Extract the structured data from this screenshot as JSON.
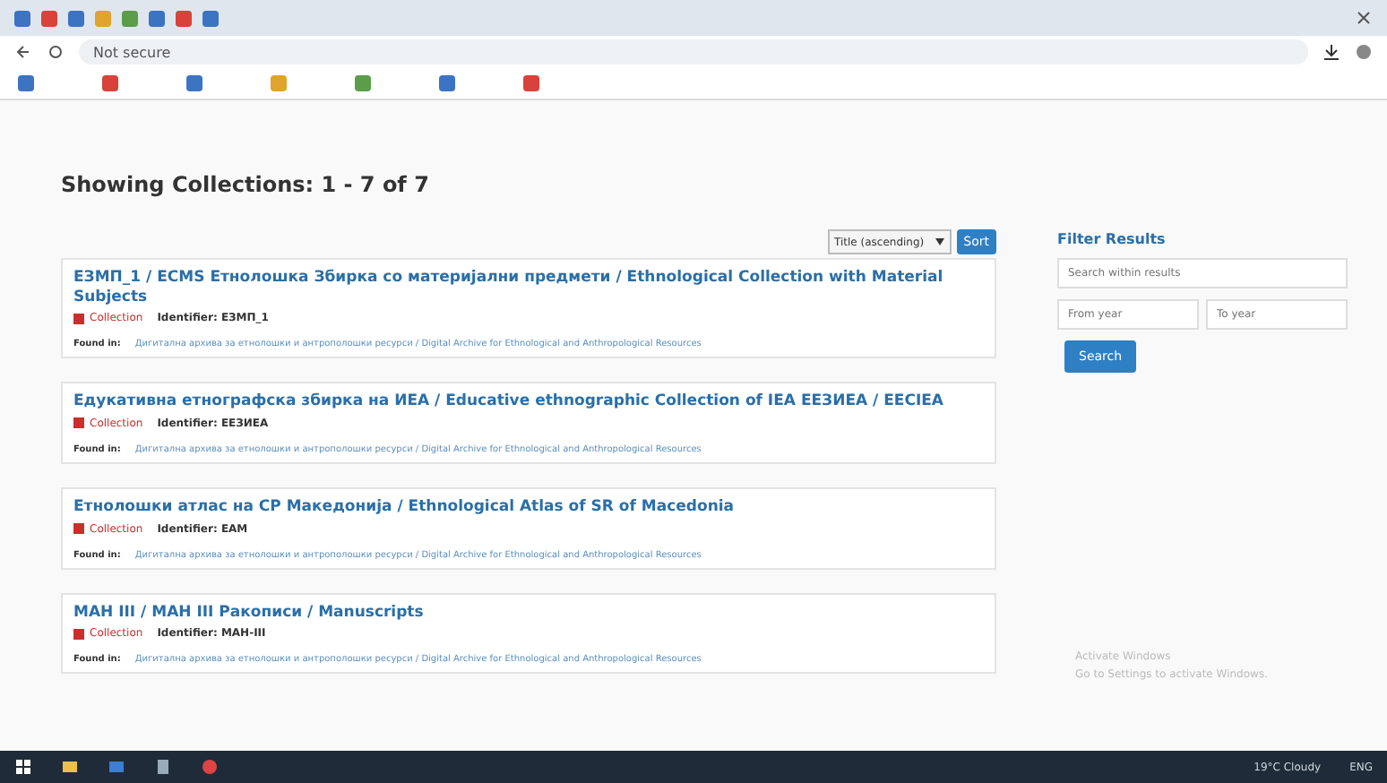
{
  "browser": {
    "address": {
      "security": "Not secure"
    }
  },
  "heading": "Showing Collections: 1 - 7 of 7",
  "sort": {
    "value": "Title (ascending)",
    "button": "Sort"
  },
  "results": [
    {
      "title": "ЕЗМП_1 / ECMS Етнолошка Збирка со материјални предмети / Ethnological Collection with Material Subjects",
      "type": "Collection",
      "identifier": "Identifier: ЕЗМП_1",
      "found_label": "Found in:",
      "found_in": "Дигитална архива за етнолошки и антрополошки ресурси / Digital Archive for Ethnological and Anthropological Resources"
    },
    {
      "title": "Едукативна етнографска збирка на ИЕА / Educative ethnographic Collection of IEA ЕЕЗИЕА / EECIEA",
      "type": "Collection",
      "identifier": "Identifier: ЕЕЗИЕА",
      "found_label": "Found in:",
      "found_in": "Дигитална архива за етнолошки и антрополошки ресурси / Digital Archive for Ethnological and Anthropological Resources"
    },
    {
      "title": "Етнолошки атлас на СР Македонија / Ethnological Atlas of SR of Macedonia",
      "type": "Collection",
      "identifier": "Identifier: ЕАМ",
      "found_label": "Found in:",
      "found_in": "Дигитална архива за етнолошки и антрополошки ресурси / Digital Archive for Ethnological and Anthropological Resources"
    },
    {
      "title": "МАН III / МАН III Ракописи / Manuscripts",
      "type": "Collection",
      "identifier": "Identifier: МАН-III",
      "found_label": "Found in:",
      "found_in": "Дигитална архива за етнолошки и антрополошки ресурси / Digital Archive for Ethnological and Anthropological Resources"
    }
  ],
  "filter": {
    "title": "Filter Results",
    "search": {
      "placeholder": "Search within results"
    },
    "from": {
      "placeholder": "From year"
    },
    "to": {
      "placeholder": "To year"
    },
    "button": "Search"
  },
  "watermark_notice": {
    "title": "Activate Windows",
    "text": "Go to Settings to activate Windows."
  },
  "taskbar": {
    "weather": "19°C Cloudy",
    "language": "ENG"
  }
}
